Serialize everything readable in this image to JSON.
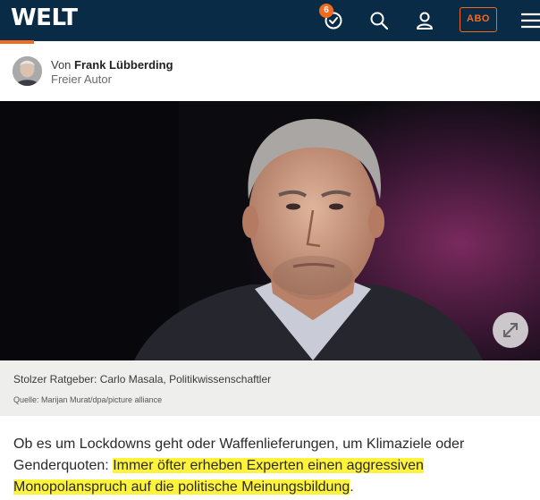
{
  "header": {
    "logo_text": "WELT",
    "notification_count": "6",
    "abo_label": "ABO",
    "background": "#0a2b45",
    "accent": "#f26a21"
  },
  "author": {
    "prefix": "Von",
    "name": "Frank Lübberding",
    "role": "Freier Autor"
  },
  "image": {
    "caption": "Stolzer Ratgeber: Carlo Masala, Politikwissenschaftler",
    "source": "Quelle: Marijan Murat/dpa/picture alliance"
  },
  "article": {
    "lead_start": "Ob es um Lockdowns geht oder Waffenlieferungen, um Klimaziele oder Genderquoten: ",
    "lead_highlight": "Immer öfter erheben Experten einen aggressiven Monopolanspruch auf die politische Meinungsbildung",
    "lead_end": ".",
    "highlight_color": "#fff43a"
  },
  "icons": {
    "history": "history-clock-icon",
    "search": "search-icon",
    "user": "user-icon",
    "menu": "hamburger-menu-icon",
    "expand": "expand-arrows-icon"
  }
}
